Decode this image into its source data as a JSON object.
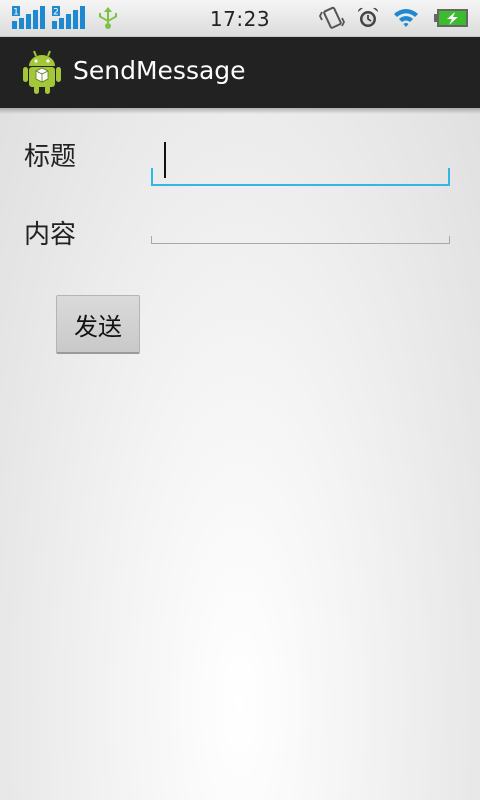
{
  "status_bar": {
    "time": "17:23",
    "sim1_label": "1",
    "sim2_label": "2",
    "icons": [
      "signal-sim1-icon",
      "signal-sim2-icon",
      "usb-icon",
      "vibrate-icon",
      "alarm-icon",
      "wifi-icon",
      "battery-charging-icon"
    ]
  },
  "action_bar": {
    "app_icon": "android-robot-icon",
    "title": "SendMessage"
  },
  "form": {
    "title_label": "标题",
    "title_value": "",
    "content_label": "内容",
    "content_value": "",
    "send_label": "发送"
  },
  "colors": {
    "focus_accent": "#33b5e5",
    "action_bar": "#222222",
    "usb_green": "#7cc243",
    "signal_blue": "#1e88d0"
  }
}
